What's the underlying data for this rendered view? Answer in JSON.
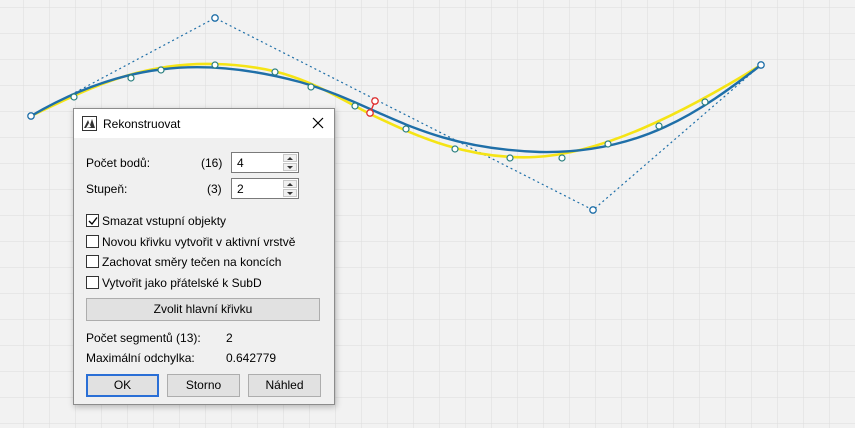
{
  "dialog": {
    "title": "Rekonstruovat",
    "point_count": {
      "label": "Počet bodů:",
      "original": "(16)",
      "value": "4"
    },
    "degree": {
      "label": "Stupeň:",
      "original": "(3)",
      "value": "2"
    },
    "checkboxes": [
      {
        "label": "Smazat vstupní objekty",
        "checked": true
      },
      {
        "label": "Novou křivku vytvořit v aktivní vrstvě",
        "checked": false
      },
      {
        "label": "Zachovat směry tečen na koncích",
        "checked": false
      },
      {
        "label": "Vytvořit jako přátelské k SubD",
        "checked": false
      }
    ],
    "select_main_curve_label": "Zvolit hlavní křivku",
    "segment_count": {
      "label": "Počet segmentů (13):",
      "value": "2"
    },
    "max_deviation": {
      "label": "Maximální odchylka:",
      "value": "0.642779"
    },
    "buttons": {
      "ok": "OK",
      "cancel": "Storno",
      "preview": "Náhled"
    }
  },
  "colors": {
    "grid_line": "#e0e0e0",
    "rebuilt_curve": "#1f6fa8",
    "original_curve": "#f5e415",
    "control_polygon": "#1f6fa8",
    "highlight_points": "#e03030",
    "default_button_border": "#2a6fd6"
  },
  "icons": {
    "app": "rhino-rebuild-icon",
    "close": "close-icon",
    "checkbox_checked": "checkmark-icon"
  }
}
